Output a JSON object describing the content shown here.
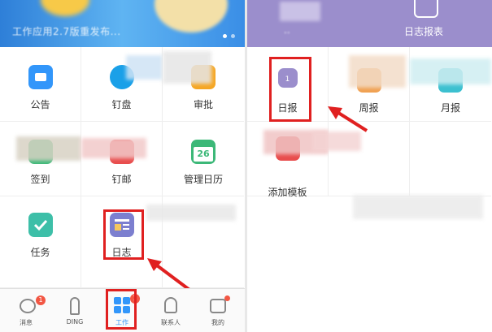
{
  "left": {
    "banner": {
      "text": "工作应用2.7版重发布..."
    },
    "grid": [
      {
        "label": "公告",
        "icon": "announcement-icon",
        "color": "#3296fa"
      },
      {
        "label": "钉盘",
        "icon": "cloud-disk-icon",
        "color": "#1aa0e8"
      },
      {
        "label": "审批",
        "icon": "approval-icon",
        "color": "#f5a623"
      },
      {
        "label": "签到",
        "icon": "checkin-icon",
        "color": "#3cb878"
      },
      {
        "label": "钉邮",
        "icon": "mail-icon",
        "color": "#e84d4d"
      },
      {
        "label": "管理日历",
        "icon": "calendar-icon",
        "color": "#3cb878",
        "icon_text": "26"
      },
      {
        "label": "任务",
        "icon": "task-check-icon",
        "color": "#3dbfa8"
      },
      {
        "label": "日志",
        "icon": "log-icon",
        "color": "#7c7fcf"
      }
    ],
    "tabs": [
      {
        "label": "消息",
        "icon": "message-icon",
        "badge": "1"
      },
      {
        "label": "DING",
        "icon": "ding-icon",
        "badge": ""
      },
      {
        "label": "工作",
        "icon": "work-grid-icon",
        "badge": "1"
      },
      {
        "label": "联系人",
        "icon": "contacts-icon",
        "badge": ""
      },
      {
        "label": "我的",
        "icon": "profile-icon",
        "badge": ""
      }
    ]
  },
  "right": {
    "header": {
      "left_label": "..",
      "right_label": "日志报表"
    },
    "grid": [
      {
        "label": "日报",
        "icon": "daily-report-icon",
        "icon_text": "1",
        "color": "#9b8ecc"
      },
      {
        "label": "周报",
        "icon": "weekly-report-icon",
        "color": "#f0a050"
      },
      {
        "label": "月报",
        "icon": "monthly-report-icon",
        "color": "#3cc0d0"
      },
      {
        "label": "添加模板",
        "icon": "add-template-icon",
        "color": "#e84d4d"
      }
    ]
  },
  "colors": {
    "highlight": "#e02020",
    "accent": "#3296fa",
    "log_purple": "#9b8ecc"
  }
}
